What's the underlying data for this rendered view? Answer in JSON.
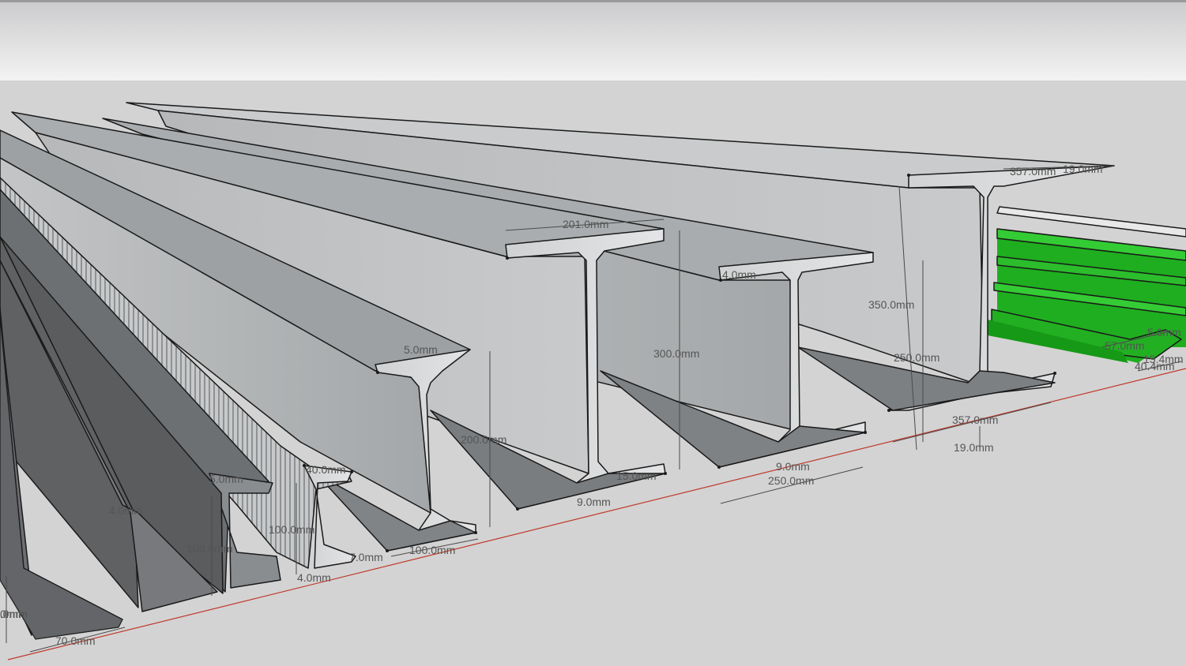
{
  "model": {
    "colors": {
      "sky_top": "#cfcfd1",
      "sky_bottom": "#f4f4f4",
      "ground": "#d3d3d3",
      "steel_light": "#b9bcbe",
      "steel_mid": "#9a9da0",
      "steel_dark": "#6f7275",
      "channel_dark": "#5e6062",
      "selected_green": "#1fb61f",
      "axis_red": "#c0392b",
      "edge": "#1a1a1a",
      "dimension_text": "#555555"
    },
    "beams": [
      {
        "id": "angle-70",
        "profile": "angle",
        "material": "steel_dark"
      },
      {
        "id": "channel-100",
        "profile": "channel",
        "material": "steel_dark"
      },
      {
        "id": "tee-100",
        "profile": "tee",
        "material": "steel_dark"
      },
      {
        "id": "i-beam-100",
        "profile": "i-beam",
        "material": "steel_light"
      },
      {
        "id": "i-beam-200",
        "profile": "i-beam",
        "material": "steel_light"
      },
      {
        "id": "h-beam-300",
        "profile": "i-beam",
        "material": "steel_light"
      },
      {
        "id": "h-beam-350-250",
        "profile": "i-beam",
        "material": "steel_light"
      },
      {
        "id": "h-beam-357",
        "profile": "i-beam",
        "material": "steel_light"
      },
      {
        "id": "green-channels",
        "profile": "channel",
        "material": "selected_green"
      }
    ],
    "dimensions": [
      {
        "id": "d-70-0",
        "text": "70.0mm"
      },
      {
        "id": "d-4-0-angle",
        "text": "4.0mm"
      },
      {
        "id": "d-0mm-cut",
        "text": "0mm"
      },
      {
        "id": "d-4-0-channel",
        "text": "4.0mm"
      },
      {
        "id": "d-100-0-channel",
        "text": "100.0mm"
      },
      {
        "id": "d-5-0-tee",
        "text": "5.0mm"
      },
      {
        "id": "d-40-0",
        "text": "40.0mm"
      },
      {
        "id": "d-100-0-tee",
        "text": "100.0mm"
      },
      {
        "id": "d-4-0-tee",
        "text": "4.0mm"
      },
      {
        "id": "d-7-0",
        "text": "7.0mm"
      },
      {
        "id": "d-100-0-flange",
        "text": "100.0mm"
      },
      {
        "id": "d-5-0-ibeam",
        "text": "5.0mm"
      },
      {
        "id": "d-200-0",
        "text": "200.0mm"
      },
      {
        "id": "d-201-0",
        "text": "201.0mm"
      },
      {
        "id": "d-15-0",
        "text": "15.0mm"
      },
      {
        "id": "d-9-0-a",
        "text": "9.0mm"
      },
      {
        "id": "d-300-0",
        "text": "300.0mm"
      },
      {
        "id": "d-4-0-top",
        "text": "4.0mm"
      },
      {
        "id": "d-9-0-b",
        "text": "9.0mm"
      },
      {
        "id": "d-250-0-flange",
        "text": "250.0mm"
      },
      {
        "id": "d-350-0",
        "text": "350.0mm"
      },
      {
        "id": "d-250-0-height",
        "text": "250.0mm"
      },
      {
        "id": "d-357-0-top",
        "text": "357.0mm"
      },
      {
        "id": "d-19-0-top",
        "text": "19.0mm"
      },
      {
        "id": "d-357-0-bottom",
        "text": "357.0mm"
      },
      {
        "id": "d-19-0-bottom",
        "text": "19.0mm"
      },
      {
        "id": "d-57-0",
        "text": "57.0mm"
      },
      {
        "id": "d-5-0-green",
        "text": "5.0mm"
      },
      {
        "id": "d-15-4",
        "text": "15.4mm"
      },
      {
        "id": "d-40-4",
        "text": "40.4mm"
      }
    ]
  }
}
